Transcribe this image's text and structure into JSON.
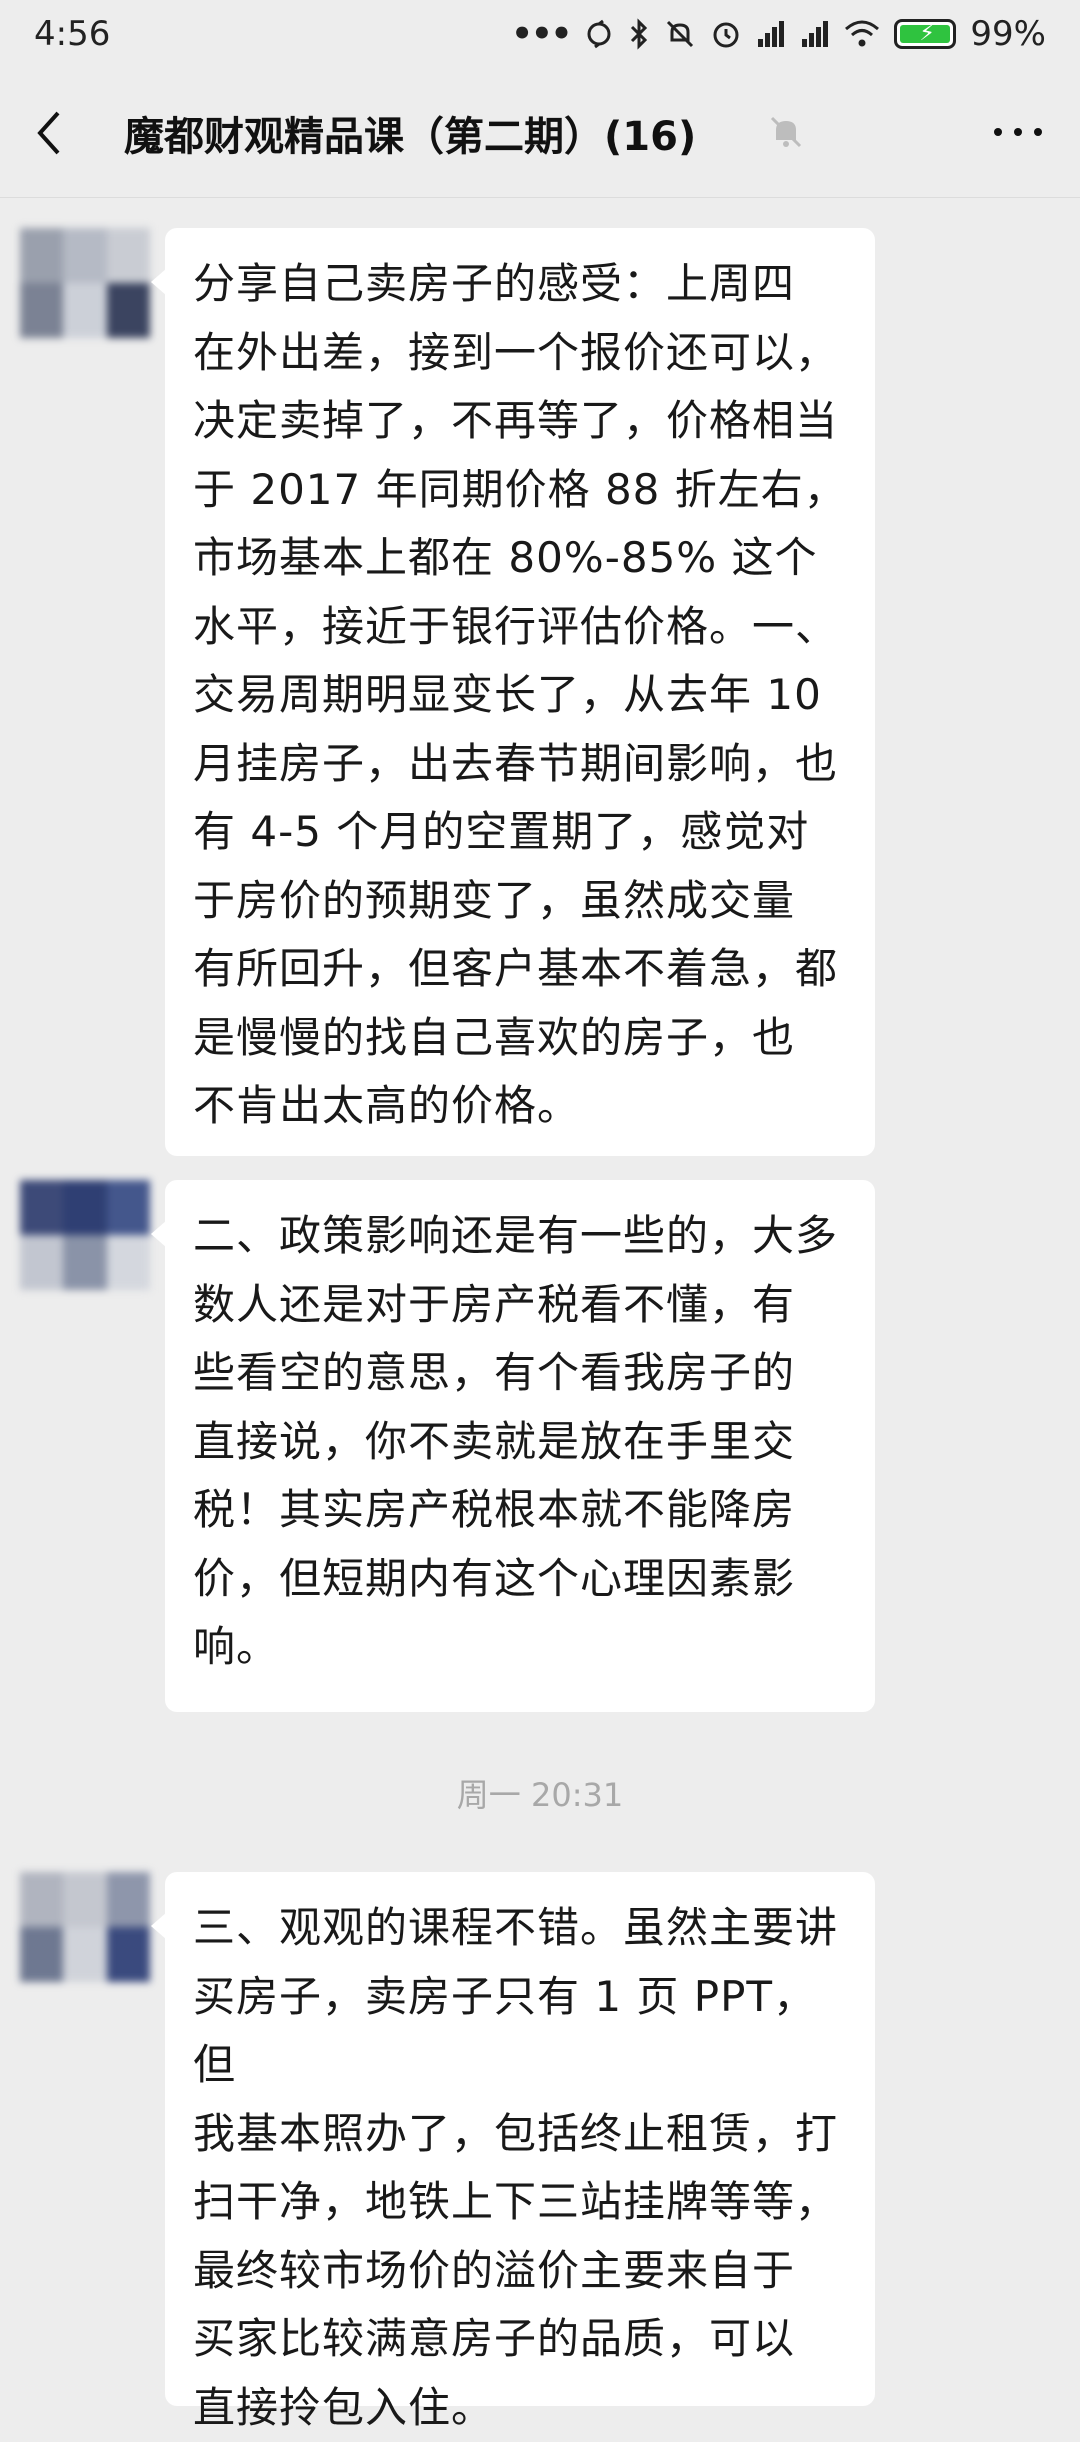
{
  "status_bar": {
    "time": "4:56",
    "battery_percent": "99%",
    "icons": [
      "more-dots-icon",
      "sync-icon",
      "bluetooth-icon",
      "silent-icon",
      "alarm-icon",
      "signal-icon",
      "signal-icon",
      "wifi-icon",
      "battery-charging-icon"
    ]
  },
  "nav": {
    "title": "魔都财观精品课（第二期）(16)",
    "back_icon": "chevron-left-icon",
    "mute_icon": "muted-bell-icon",
    "more_icon": "more-horizontal-icon"
  },
  "messages": [
    {
      "lines": [
        "分享自己卖房子的感受：上周四",
        "在外出差，接到一个报价还可以，",
        "决定卖掉了，不再等了，价格相当",
        "于 2017 年同期价格 88 折左右，",
        "市场基本上都在 80%-85% 这个",
        "水平，接近于银行评估价格。一、",
        "交易周期明显变长了，从去年 10",
        "月挂房子，出去春节期间影响，也",
        "有 4-5 个月的空置期了，感觉对",
        "于房价的预期变了，虽然成交量",
        "有所回升，但客户基本不着急，都",
        "是慢慢的找自己喜欢的房子，也",
        "不肯出太高的价格。"
      ]
    },
    {
      "lines": [
        "二、政策影响还是有一些的，大多",
        "数人还是对于房产税看不懂，有",
        "些看空的意思，有个看我房子的",
        "直接说，你不卖就是放在手里交",
        "税！其实房产税根本就不能降房",
        "价，但短期内有这个心理因素影",
        "响。"
      ]
    },
    {
      "lines": [
        "三、观观的课程不错。虽然主要讲",
        "买房子，卖房子只有 1 页 PPT，但",
        "我基本照办了，包括终止租赁，打",
        "扫干净，地铁上下三站挂牌等等，",
        "最终较市场价的溢价主要来自于",
        "买家比较满意房子的品质，可以",
        "直接拎包入住。"
      ]
    }
  ],
  "time_divider": "周一 20:31",
  "colors": {
    "background": "#ededed",
    "bubble": "#ffffff",
    "text": "#191919",
    "timestamp": "#a8a8a8",
    "battery_fill": "#2fc33f"
  }
}
